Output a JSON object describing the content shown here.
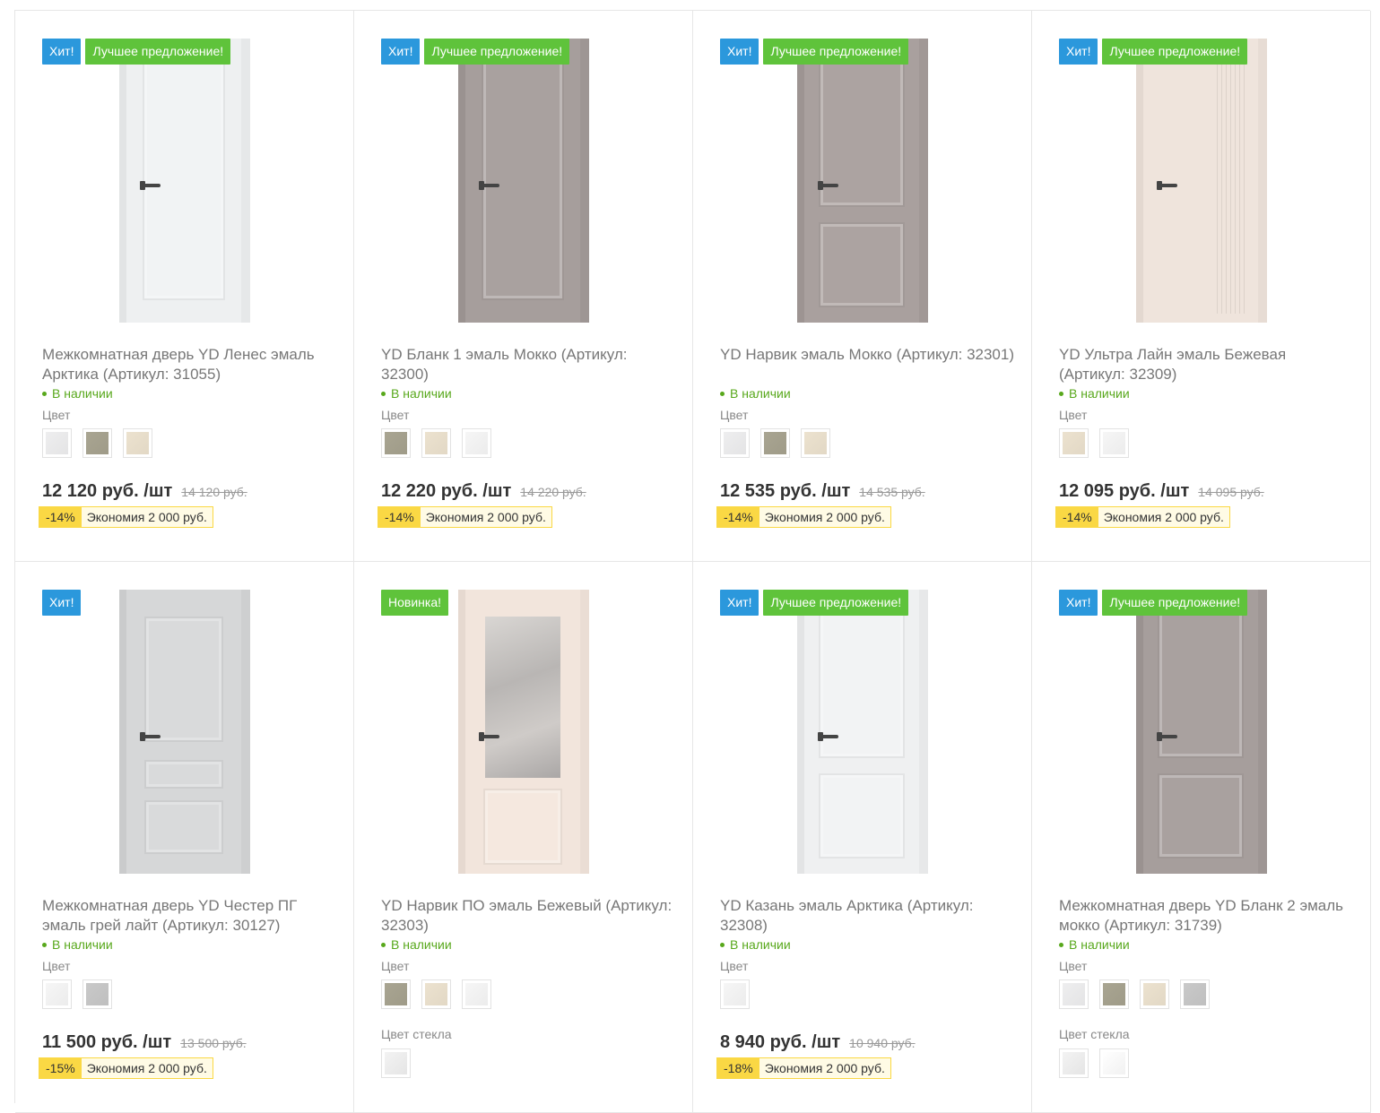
{
  "products": [
    {
      "labels": [
        {
          "type": "hit",
          "text": "Хит!"
        },
        {
          "type": "best",
          "text": "Лучшее предложение!"
        }
      ],
      "title": "Межкомнатная дверь YD Ленес эмаль Арктика (Артикул: 31055)",
      "stock": "В наличии",
      "color_title": "Цвет",
      "colors": [
        "#eeeeef",
        "#a9a592",
        "#ece2cf"
      ],
      "glass_title": "",
      "glass_colors": [],
      "price": "12 120 руб. /шт",
      "old_price": "14 120 руб.",
      "discount": "-14%",
      "economy": "Экономия 2 000 руб.",
      "door": {
        "color": "#eef0f1",
        "style": "single-panel"
      }
    },
    {
      "labels": [
        {
          "type": "hit",
          "text": "Хит!"
        },
        {
          "type": "best",
          "text": "Лучшее предложение!"
        }
      ],
      "title": "YD Бланк 1 эмаль Мокко (Артикул: 32300)",
      "stock": "В наличии",
      "color_title": "Цвет",
      "colors": [
        "#a9a592",
        "#ece2cf",
        "#f6f6f6"
      ],
      "glass_title": "",
      "glass_colors": [],
      "price": "12 220 руб. /шт",
      "old_price": "14 220 руб.",
      "discount": "-14%",
      "economy": "Экономия 2 000 руб.",
      "door": {
        "color": "#a69e9c",
        "style": "single-panel"
      }
    },
    {
      "labels": [
        {
          "type": "hit",
          "text": "Хит!"
        },
        {
          "type": "best",
          "text": "Лучшее предложение!"
        }
      ],
      "title": "YD Нарвик эмаль Мокко (Артикул: 32301)",
      "stock": "В наличии",
      "color_title": "Цвет",
      "colors": [
        "#eeeeef",
        "#a9a592",
        "#ece2cf"
      ],
      "glass_title": "",
      "glass_colors": [],
      "price": "12 535 руб. /шт",
      "old_price": "14 535 руб.",
      "discount": "-14%",
      "economy": "Экономия 2 000 руб.",
      "door": {
        "color": "#a9a09e",
        "style": "two-panel"
      }
    },
    {
      "labels": [
        {
          "type": "hit",
          "text": "Хит!"
        },
        {
          "type": "best",
          "text": "Лучшее предложение!"
        }
      ],
      "title": "YD Ультра Лайн эмаль Бежевая (Артикул: 32309)",
      "stock": "В наличии",
      "color_title": "Цвет",
      "colors": [
        "#ece2cf",
        "#f6f6f6"
      ],
      "glass_title": "",
      "glass_colors": [],
      "price": "12 095 руб. /шт",
      "old_price": "14 095 руб.",
      "discount": "-14%",
      "economy": "Экономия 2 000 руб.",
      "door": {
        "color": "#efe4dc",
        "style": "lines"
      }
    },
    {
      "labels": [
        {
          "type": "hit",
          "text": "Хит!"
        }
      ],
      "title": "Межкомнатная дверь YD Честер ПГ эмаль грей лайт (Артикул: 30127)",
      "stock": "В наличии",
      "color_title": "Цвет",
      "colors": [
        "#f6f6f6",
        "#c9c9c9"
      ],
      "glass_title": "",
      "glass_colors": [],
      "price": "11 500 руб. /шт",
      "old_price": "13 500 руб.",
      "discount": "-15%",
      "economy": "Экономия 2 000 руб.",
      "door": {
        "color": "#d6d7d8",
        "style": "three-panel"
      }
    },
    {
      "labels": [
        {
          "type": "new",
          "text": "Новинка!"
        }
      ],
      "title": "YD Нарвик ПО эмаль Бежевый (Артикул: 32303)",
      "stock": "В наличии",
      "color_title": "Цвет",
      "colors": [
        "#a9a592",
        "#ece2cf",
        "#f6f6f6"
      ],
      "glass_title": "Цвет стекла",
      "glass_colors": [
        "#f3f3f3"
      ],
      "price": "",
      "old_price": "",
      "discount": "",
      "economy": "",
      "door": {
        "color": "#f2e5dc",
        "style": "glass"
      }
    },
    {
      "labels": [
        {
          "type": "hit",
          "text": "Хит!"
        },
        {
          "type": "best",
          "text": "Лучшее предложение!"
        }
      ],
      "title": "YD Казань эмаль Арктика (Артикул: 32308)",
      "stock": "В наличии",
      "color_title": "Цвет",
      "colors": [
        "#f6f6f6"
      ],
      "glass_title": "",
      "glass_colors": [],
      "price": "8 940 руб. /шт",
      "old_price": "10 940 руб.",
      "discount": "-18%",
      "economy": "Экономия 2 000 руб.",
      "door": {
        "color": "#eff0f1",
        "style": "two-panel"
      }
    },
    {
      "labels": [
        {
          "type": "hit",
          "text": "Хит!"
        },
        {
          "type": "best",
          "text": "Лучшее предложение!"
        }
      ],
      "title": "Межкомнатная дверь YD Бланк 2 эмаль мокко (Артикул: 31739)",
      "stock": "В наличии",
      "color_title": "Цвет",
      "colors": [
        "#eeeeef",
        "#a9a592",
        "#ece2cf",
        "#c9c9c9"
      ],
      "glass_title": "Цвет стекла",
      "glass_colors": [
        "#f3f3f3",
        "#ffffff"
      ],
      "price": "",
      "old_price": "",
      "discount": "",
      "economy": "",
      "door": {
        "color": "#a69e9c",
        "style": "two-panel-tall"
      }
    }
  ]
}
